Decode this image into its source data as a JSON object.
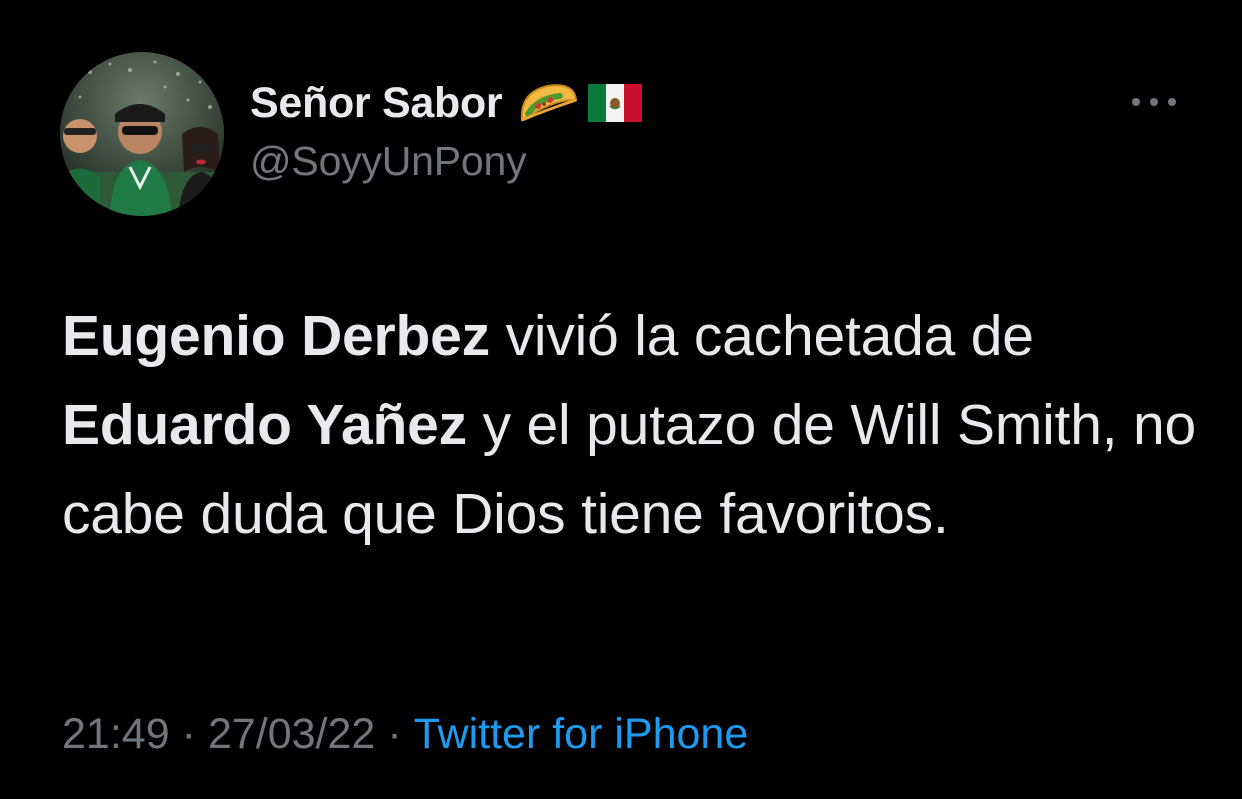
{
  "author": {
    "display_name": "Señor Sabor",
    "handle": "@SoyyUnPony",
    "emojis": [
      "taco-emoji",
      "mexico-flag-emoji"
    ]
  },
  "tweet": {
    "parts": [
      {
        "text": "Eugenio Derbez",
        "bold": true
      },
      {
        "text": " vivió la cachetada de ",
        "bold": false
      },
      {
        "text": "Eduardo Yañez",
        "bold": true
      },
      {
        "text": " y el putazo de Will Smith, no cabe duda que Dios tiene favoritos.",
        "bold": false
      }
    ]
  },
  "meta": {
    "time": "21:49",
    "date": "27/03/22",
    "separator": "·",
    "source": "Twitter for iPhone"
  },
  "icons": {
    "more": "more-horizontal-icon"
  },
  "colors": {
    "background": "#000000",
    "text": "#e7e9ea",
    "muted": "#71767b",
    "link": "#1d9bf0"
  }
}
